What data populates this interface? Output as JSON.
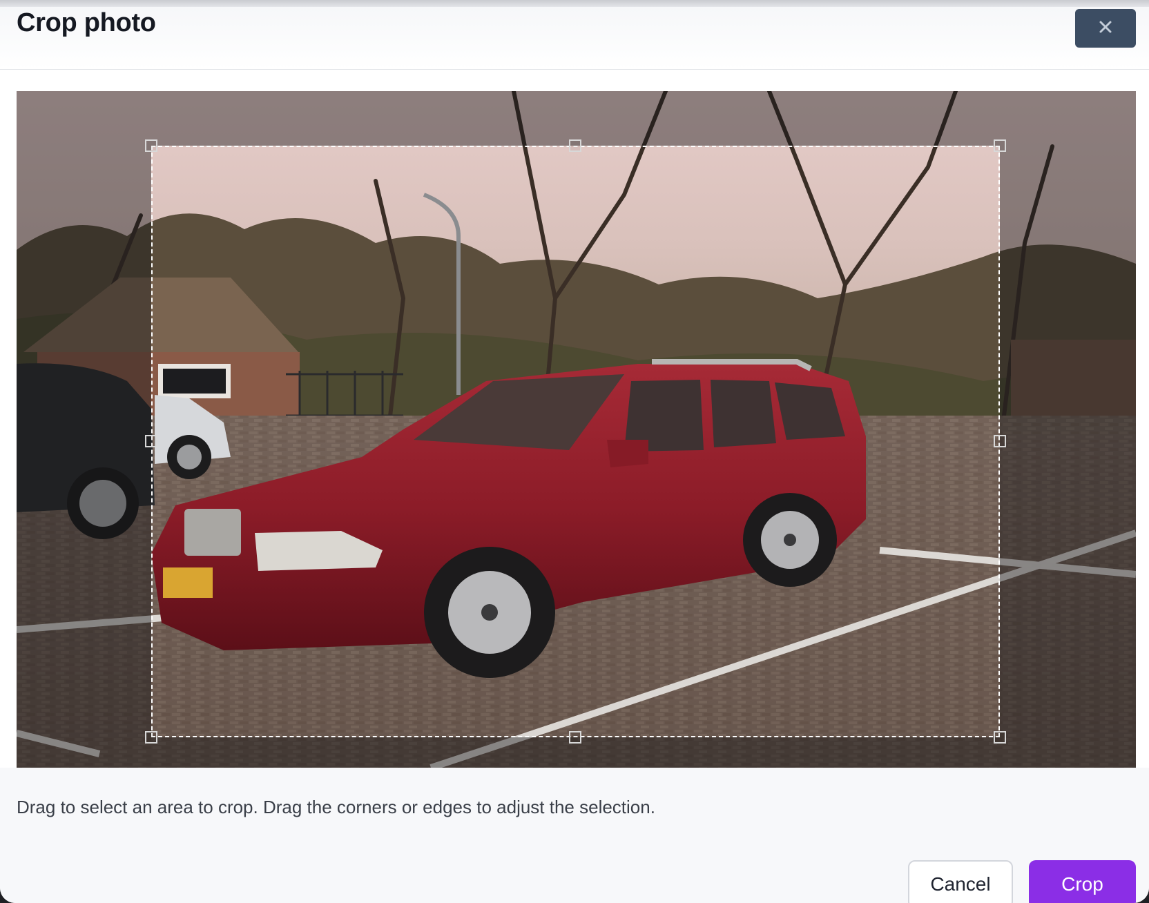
{
  "dialog": {
    "title": "Crop photo",
    "close_icon": "close-icon"
  },
  "editor": {
    "hint": "Drag to select an area to crop. Drag the corners or edges to adjust the selection."
  },
  "actions": {
    "cancel_label": "Cancel",
    "crop_label": "Crop"
  },
  "colors": {
    "primary": "#8b2ee6",
    "close_button_bg": "#3c4d63"
  }
}
